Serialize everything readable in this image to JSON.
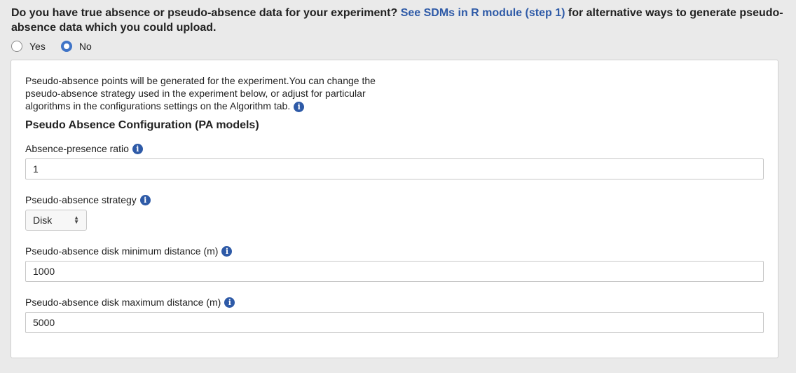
{
  "question": {
    "text_before": "Do you have true absence or pseudo-absence data for your experiment? ",
    "link": "See SDMs in R module (step 1)",
    "text_after": " for alternative ways to generate pseudo-absence data which you could upload."
  },
  "radio_options": [
    {
      "label": "Yes",
      "checked": false
    },
    {
      "label": "No",
      "checked": true
    }
  ],
  "panel": {
    "intro": "Pseudo-absence points will be generated for the experiment.You can change the pseudo-absence strategy used in the experiment below, or adjust for particular algorithms in the configurations settings on the Algorithm tab.",
    "section_title": "Pseudo Absence Configuration (PA models)",
    "fields": {
      "ratio": {
        "label": "Absence-presence ratio",
        "value": "1"
      },
      "strategy": {
        "label": "Pseudo-absence strategy",
        "value": "Disk"
      },
      "min_distance": {
        "label": "Pseudo-absence disk minimum distance (m)",
        "value": "1000"
      },
      "max_distance": {
        "label": "Pseudo-absence disk maximum distance (m)",
        "value": "5000"
      }
    }
  },
  "icons": {
    "info": "info-icon"
  },
  "colors": {
    "link": "#2e5aa7",
    "radio_checked": "#3f74c7",
    "info_icon": "#2e5aa7"
  }
}
